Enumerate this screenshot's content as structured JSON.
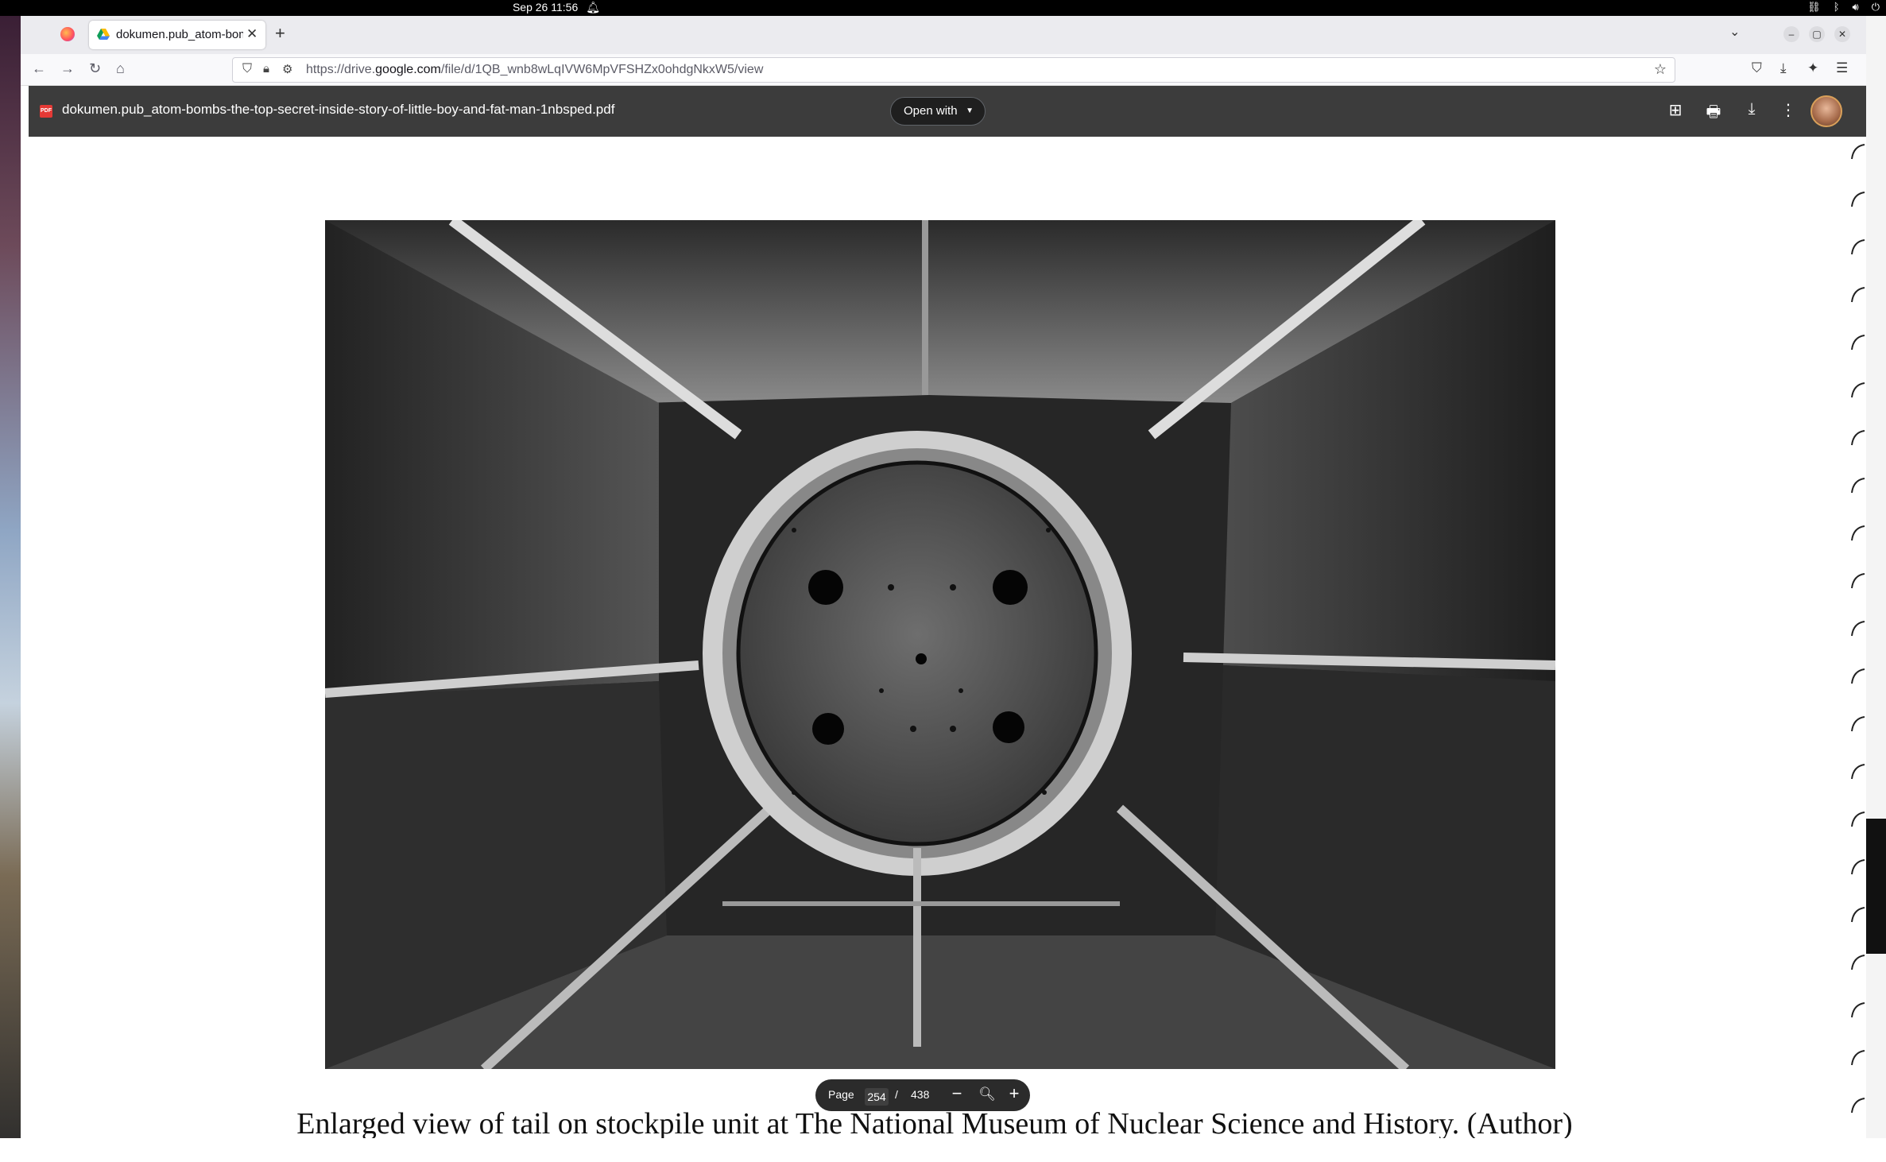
{
  "system": {
    "datetime": "Sep 26  11:56"
  },
  "browser": {
    "tab": {
      "title": "dokumen.pub_atom-bom"
    },
    "url": {
      "prefix": "https://drive.",
      "domain": "google.com",
      "path": "/file/d/1QB_wnb8wLqIVW6MpVFSHZx0ohdgNkxW5/view"
    }
  },
  "viewer": {
    "file_badge": "PDF",
    "file_title": "dokumen.pub_atom-bombs-the-top-secret-inside-story-of-little-boy-and-fat-man-1nbsped.pdf",
    "open_with_label": "Open with",
    "caption": "Enlarged view of tail on stockpile unit at The National Museum of Nuclear Science and History.  (Author)",
    "pager": {
      "page_label": "Page",
      "current_page": "254",
      "separator": "/",
      "total_pages": "438"
    }
  },
  "colors": {
    "viewer_header": "#3c3c3c",
    "tab_bar": "#ebebef",
    "page_background": "#ffffff"
  }
}
